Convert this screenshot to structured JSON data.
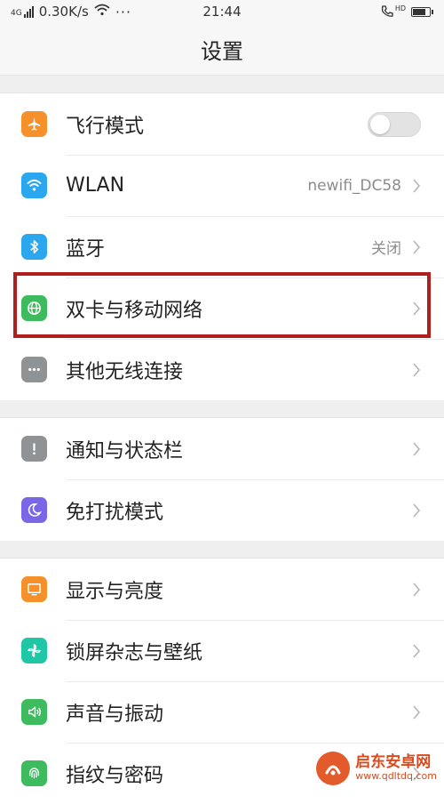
{
  "status_bar": {
    "signal": "4G",
    "speed": "0.30K/s",
    "more": "···",
    "time": "21:44",
    "hd": "HD"
  },
  "nav": {
    "title": "设置"
  },
  "groups": [
    {
      "items": [
        {
          "label": "飞行模式",
          "icon": "airplane-icon",
          "color": "#f5902a",
          "control": "toggle",
          "toggle_on": false
        },
        {
          "label": "WLAN",
          "icon": "wifi-icon",
          "color": "#2aa7ee",
          "value": "newifi_DC58",
          "control": "chevron"
        },
        {
          "label": "蓝牙",
          "icon": "bluetooth-icon",
          "color": "#2aa7ee",
          "value": "关闭",
          "control": "chevron"
        },
        {
          "label": "双卡与移动网络",
          "icon": "globe-icon",
          "color": "#3dbb5e",
          "control": "chevron"
        },
        {
          "label": "其他无线连接",
          "icon": "more-dots-icon",
          "color": "#8f9396",
          "control": "chevron"
        }
      ]
    },
    {
      "items": [
        {
          "label": "通知与状态栏",
          "icon": "exclamation-icon",
          "color": "#8f9396",
          "control": "chevron"
        },
        {
          "label": "免打扰模式",
          "icon": "moon-icon",
          "color": "#7a67e8",
          "control": "chevron"
        }
      ]
    },
    {
      "items": [
        {
          "label": "显示与亮度",
          "icon": "monitor-icon",
          "color": "#f5902a",
          "control": "chevron"
        },
        {
          "label": "锁屏杂志与壁纸",
          "icon": "pinwheel-icon",
          "color": "#1fc7a7",
          "control": "chevron"
        },
        {
          "label": "声音与振动",
          "icon": "speaker-icon",
          "color": "#3dbb5e",
          "control": "chevron"
        },
        {
          "label": "指纹与密码",
          "icon": "fingerprint-icon",
          "color": "#3dbb5e",
          "control": "chevron"
        }
      ]
    }
  ],
  "watermark": {
    "title": "启东安卓网",
    "url": "www.qdltdq.com"
  },
  "highlight_color": "#b01e1e"
}
